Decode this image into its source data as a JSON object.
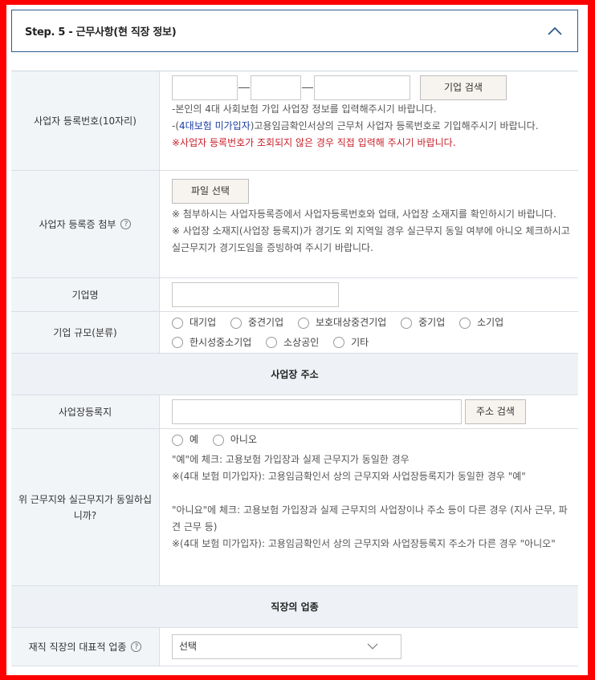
{
  "step": {
    "title": "Step. 5 - 근무사항(현 직장 정보)"
  },
  "business_number": {
    "label": "사업자 등록번호(10자리)",
    "button": "기업 검색",
    "note1": "-본인의 4대 사회보험 가입 사업장 정보를 입력해주시기 바랍니다.",
    "note2_prefix": "-(",
    "note2_highlight": "4대보험 미가입자",
    "note2_suffix": ")고용임금확인서상의 근무처 사업자 등록번호로 기입해주시기 바랍니다.",
    "note3": "※사업자 등록번호가 조회되지 않은 경우 직접 입력해 주시기 바랍니다."
  },
  "certificate": {
    "label": "사업자 등록증 첨부",
    "button": "파일 선택",
    "note1": "※ 첨부하시는 사업자등록증에서 사업자등록번호와 업태, 사업장 소재지를 확인하시기 바랍니다.",
    "note2": "※ 사업장 소재지(사업장 등록지)가 경기도 외 지역일 경우 실근무지 동일 여부에 아니오 체크하시고 실근무지가 경기도임을 증빙하여 주시기 바랍니다."
  },
  "company_name": {
    "label": "기업명"
  },
  "company_size": {
    "label": "기업 규모(분류)",
    "options_row1": [
      "대기업",
      "중견기업",
      "보호대상중견기업",
      "중기업",
      "소기업"
    ],
    "options_row2": [
      "한시성중소기업",
      "소상공인",
      "기타"
    ]
  },
  "address_section": {
    "title": "사업장 주소"
  },
  "address": {
    "label": "사업장등록지",
    "button": "주소 검색"
  },
  "same_workplace": {
    "label": "위 근무지와 실근무지가 동일하십니까?",
    "options": [
      "예",
      "아니오"
    ],
    "notes": [
      "\"예\"에 체크: 고용보험 가입장과 실제 근무지가 동일한 경우",
      "※(4대 보험 미가입자): 고용임금확인서 상의 근무지와 사업장등록지가 동일한 경우 \"예\"",
      "",
      "\"아니요\"에 체크: 고용보험 가입장과 실제 근무지의 사업장이나 주소 등이 다른 경우 (지사 근무, 파견 근무 등)",
      "※(4대 보험 미가입자): 고용임금확인서 상의 근무지와 사업장등록지 주소가 다른 경우 \"아니오\""
    ]
  },
  "industry_section": {
    "title": "직장의 업종"
  },
  "industry": {
    "label": "재직 직장의 대표적 업종",
    "select_value": "선택"
  },
  "icons": {
    "collapse": "chevron-up-icon",
    "help": "question-circle-icon",
    "dropdown": "chevron-down-icon"
  },
  "colors": {
    "border_accent": "#2d5b8a",
    "highlight_blue": "#1a3ea6",
    "warning_red": "#c8202a",
    "frame": "#ff0000"
  }
}
